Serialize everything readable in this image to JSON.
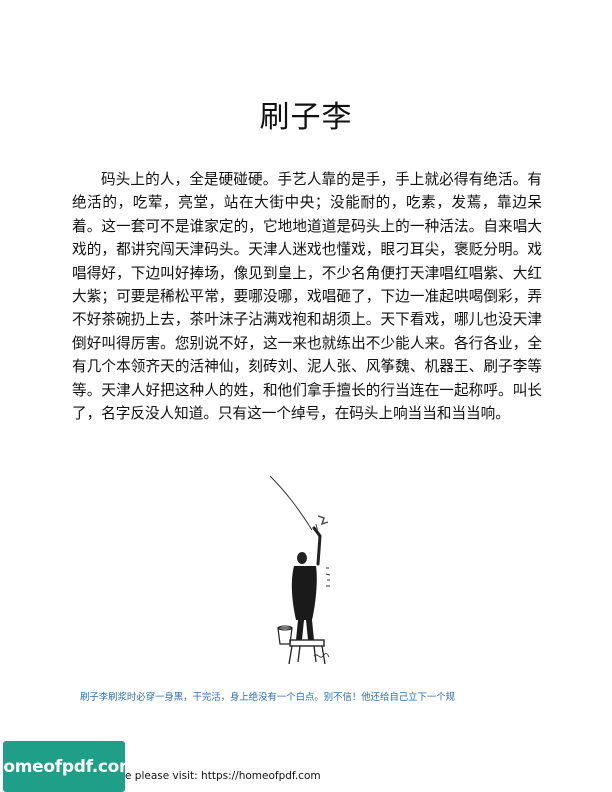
{
  "document": {
    "title": "刷子李",
    "paragraph": "码头上的人，全是硬碰硬。手艺人靠的是手，手上就必得有绝活。有绝活的，吃荤，亮堂，站在大街中央；没能耐的，吃素，发蔫，靠边呆着。这一套可不是谁家定的，它地地道道是码头上的一种活法。自来唱大戏的，都讲究闯天津码头。天津人迷戏也懂戏，眼刁耳尖，褒贬分明。戏唱得好，下边叫好捧场，像见到皇上，不少名角便打天津唱红唱紫、大红大紫；可要是稀松平常，要哪没哪，戏唱砸了，下边一准起哄喝倒彩，弄不好茶碗扔上去，茶叶沫子沾满戏袍和胡须上。天下看戏，哪儿也没天津倒好叫得厉害。您别说不好，这一来也就练出不少能人来。各行各业，全有几个本领齐天的活神仙，刻砖刘、泥人张、风筝魏、机器王、刷子李等等。天津人好把这种人的姓，和他们拿手擅长的行当连在一起称呼。叫长了，名字反没人知道。只有这一个绰号，在码头上响当当和当当响。",
    "caption": "刷子李刷浆时必穿一身黑，干完活，身上绝没有一个白点。别不信！他还给自己立下一个规"
  },
  "footer": {
    "badge_label": "homeofpdf.com",
    "text": "e please visit: https://homeofpdf.com"
  },
  "colors": {
    "caption": "#2d6fb5",
    "badge": "#1f9e88"
  }
}
